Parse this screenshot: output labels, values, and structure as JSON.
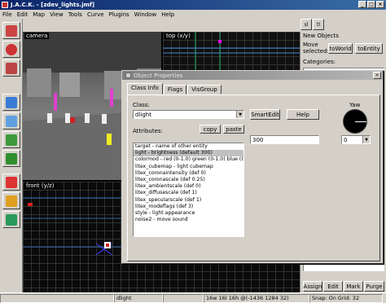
{
  "window": {
    "title": "J.A.C.K. - [zdev_lights.jmf]"
  },
  "menu": [
    "File",
    "Edit",
    "Map",
    "View",
    "Tools",
    "Curve",
    "Plugins",
    "Window",
    "Help"
  ],
  "toolbar_right": [
    "sl",
    "tl"
  ],
  "viewports": {
    "camera": "camera",
    "top": "top (x/y)",
    "front": "front (y/z)"
  },
  "right_panel": {
    "header": "New Objects",
    "move_selected": "Move selected:",
    "to_world": "toWorld",
    "to_entity": "toEntity",
    "categories": "Categories:",
    "buttons": [
      "Assign",
      "Edit",
      "Mark",
      "Purge"
    ]
  },
  "dialog": {
    "title": "Object Properties",
    "tabs": [
      "Class Info",
      "Flags",
      "VisGroup"
    ],
    "class_label": "Class:",
    "class_value": "dlight",
    "smartedit": "SmartEdit",
    "help": "Help",
    "attributes_label": "Attributes:",
    "copy": "copy",
    "paste": "paste",
    "attributes": [
      "target - name of other entity",
      "light - brightness (default 300)",
      "colormod - red (0-1.0) green (0-1.0) blue (0-",
      "litex_cubemap - light cubemap",
      "litex_coronaintensity (def 0)",
      "litex_coronascale (def 0.25)",
      "litex_ambientscale (def 0)",
      "litex_diffusescale (def 1)",
      "litex_specularscale (def 1)",
      "litex_modeflags (def 3)",
      "style - light appearance",
      "noise2 - move sound"
    ],
    "selected_index": 1,
    "value": "300",
    "yaw_label": "Yaw",
    "yaw_value": "0"
  },
  "statusbar": {
    "message": "dlight",
    "dims": "16w 16l 16h @(-1436 1284 32)",
    "snap": "Snap: On Grid: 32"
  }
}
